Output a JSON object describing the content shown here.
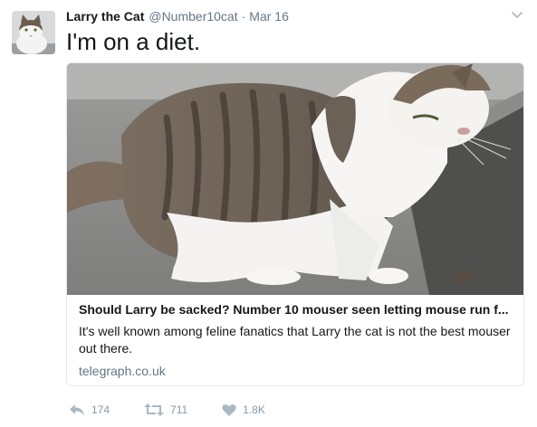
{
  "tweet": {
    "author_name": "Larry the Cat",
    "handle": "@Number10cat",
    "separator": "·",
    "time": "Mar 16",
    "text": "I'm on a diet."
  },
  "card": {
    "title": "Should Larry be sacked? Number 10 mouser seen letting mouse run f...",
    "description": "It's well known among feline fanatics that Larry the cat is not the best mouser out there.",
    "domain": "telegraph.co.uk"
  },
  "actions": {
    "reply_count": "174",
    "retweet_count": "711",
    "like_count": "1.8K"
  },
  "icons": [
    "chevron-down-icon",
    "reply-icon",
    "retweet-icon",
    "heart-icon"
  ],
  "colors": {
    "text": "#14171a",
    "secondary_text": "#657786",
    "action_gray": "#8899a6",
    "card_border": "#e1e8ed"
  }
}
